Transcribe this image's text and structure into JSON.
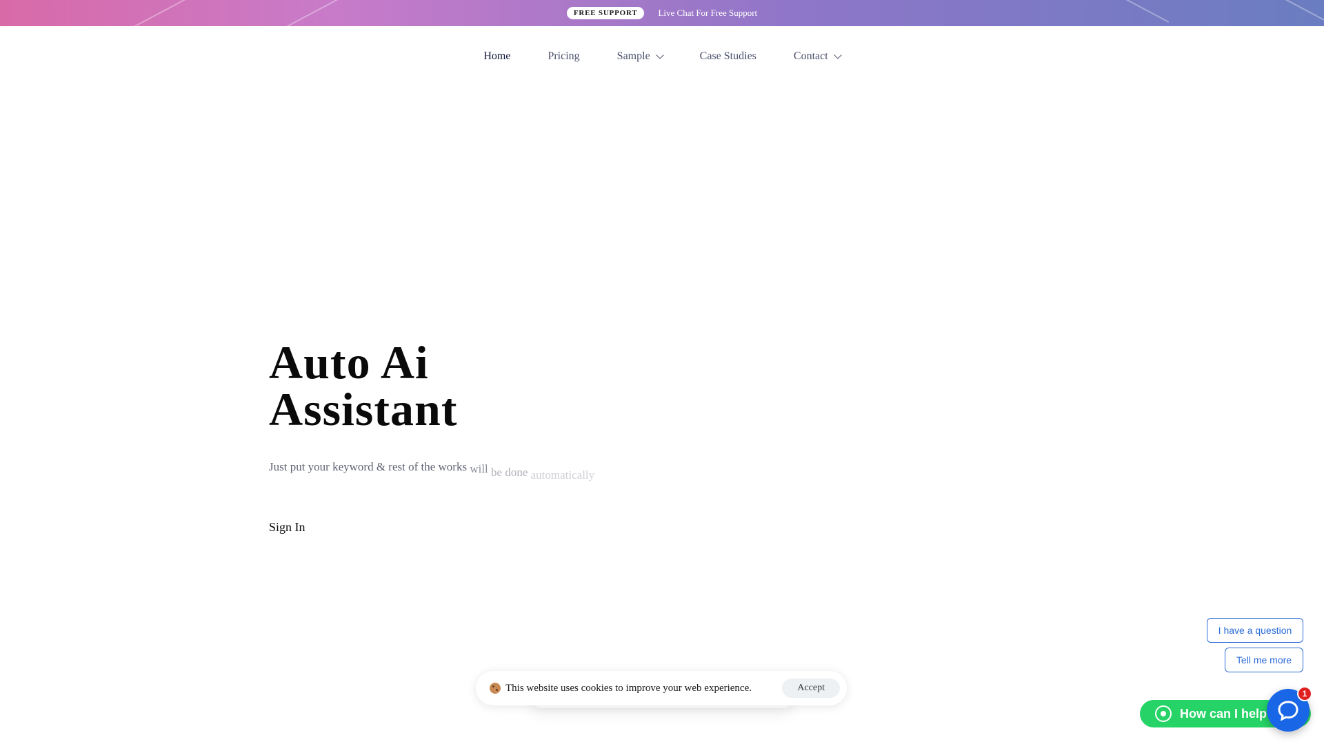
{
  "topbar": {
    "badge": "FREE SUPPORT",
    "text": "Live Chat For Free Support",
    "gradient_colors": [
      "#d96aa8",
      "#c87bc9",
      "#8f76c8",
      "#6a7dc0"
    ]
  },
  "nav": {
    "items": [
      {
        "label": "Home",
        "active": true
      },
      {
        "label": "Pricing"
      },
      {
        "label": "Sample",
        "dropdown": true
      },
      {
        "label": "Case Studies"
      },
      {
        "label": "Contact",
        "dropdown": true
      }
    ]
  },
  "hero": {
    "title_line1": "Auto Ai",
    "title_line2": "Assistant",
    "subtitle_part1": "Just put your keyword & rest of the works",
    "subtitle_part2": "will",
    "subtitle_part3": "be done",
    "subtitle_part4": "automatically",
    "signin_label": "Sign In"
  },
  "cookie": {
    "icon": "cookie-icon",
    "text": "This website uses cookies to improve your web experience.",
    "accept_label": "Accept"
  },
  "chat": {
    "chip1": "I have a question",
    "chip2": "Tell me more",
    "whatsapp_label": "How can I help you?",
    "whatsapp_icon": "whatsapp-icon",
    "whatsapp_color": "#25d366",
    "bubble_color": "#1967e6",
    "badge_count": "1"
  }
}
